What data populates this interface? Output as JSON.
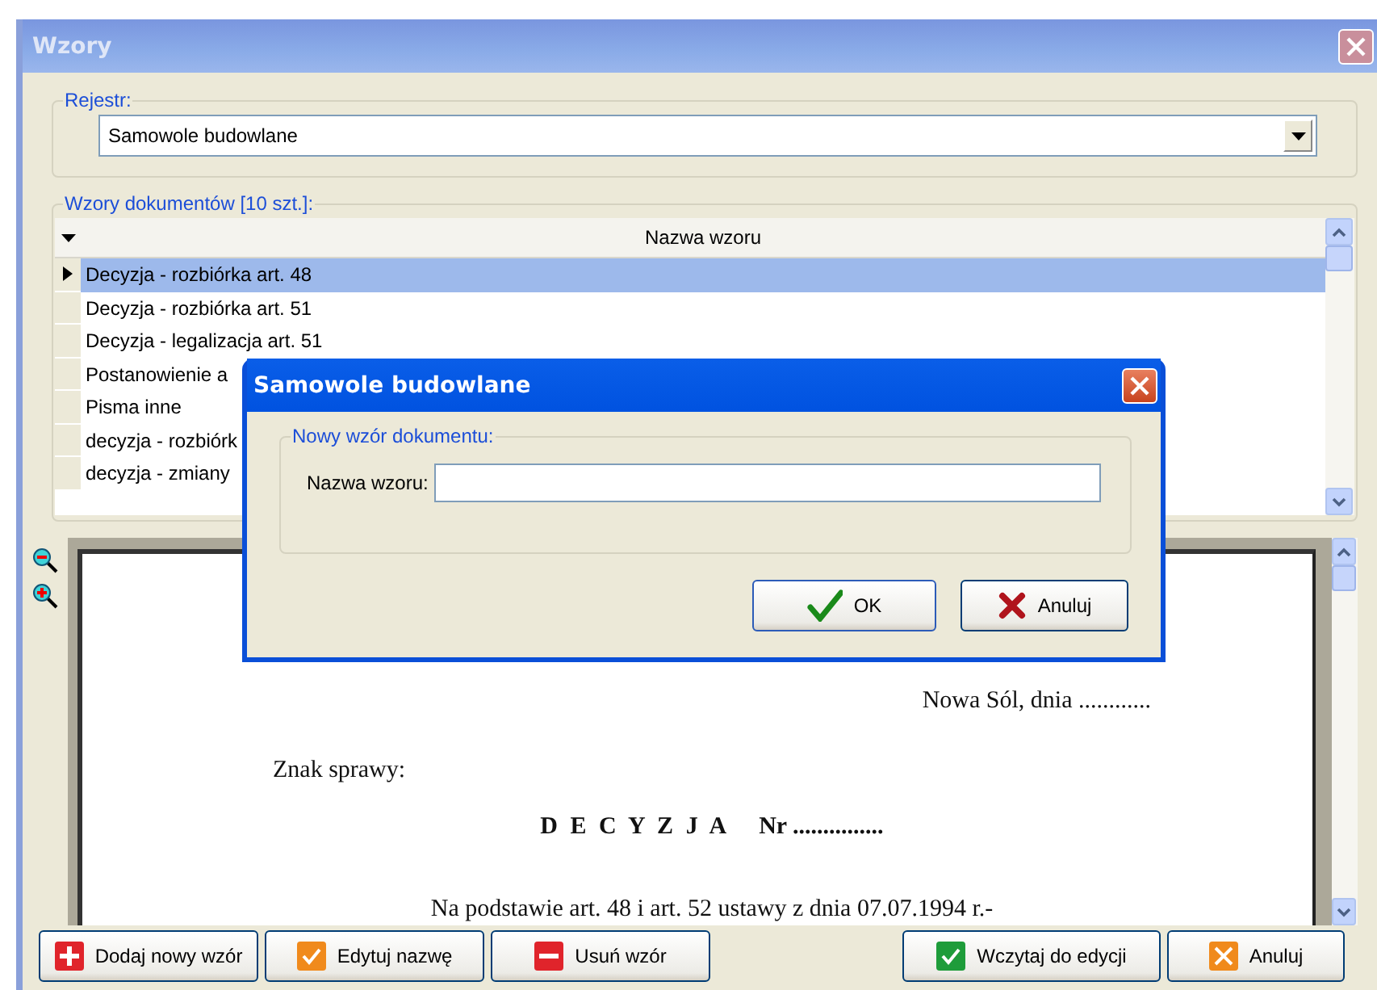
{
  "window": {
    "title": "Wzory"
  },
  "registry": {
    "label": "Rejestr:",
    "value": "Samowole budowlane"
  },
  "templates": {
    "label": "Wzory dokumentów [10 szt.]:",
    "column": "Nazwa wzoru",
    "rows": [
      {
        "name": "Decyzja - rozbiórka art. 48",
        "selected": true
      },
      {
        "name": "Decyzja - rozbiórka art. 51",
        "selected": false
      },
      {
        "name": "Decyzja - legalizacja art. 51",
        "selected": false
      },
      {
        "name": "Postanowienie a",
        "selected": false
      },
      {
        "name": "Pisma inne",
        "selected": false
      },
      {
        "name": "decyzja - rozbiórk",
        "selected": false
      },
      {
        "name": "decyzja - zmiany",
        "selected": false
      }
    ]
  },
  "preview": {
    "lines": [
      {
        "kind": "right",
        "text": "Nowa Sól, dnia ............"
      },
      {
        "kind": "left",
        "text": "Znak sprawy:"
      },
      {
        "kind": "heading",
        "text": "D E C Y Z J A",
        "suffix": "Nr ..............."
      },
      {
        "kind": "center",
        "text": "Na podstawie art. 48 i art. 52 ustawy z dnia 07.07.1994 r.-"
      }
    ]
  },
  "buttons": [
    "Dodaj nowy wzór",
    "Edytuj nazwę",
    "Usuń wzór",
    "Wczytaj do edycji",
    "Anuluj"
  ],
  "dialog": {
    "title": "Samowole budowlane",
    "group": "Nowy wzór dokumentu:",
    "field_label": "Nazwa wzoru:",
    "buttons": [
      "OK",
      "Anuluj"
    ]
  }
}
